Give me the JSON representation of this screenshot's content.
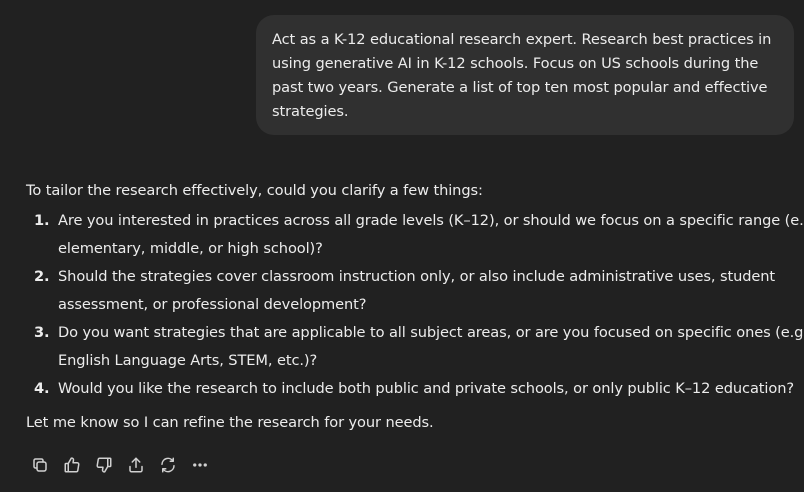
{
  "user_message": {
    "lines": [
      "Act as a K-12 educational research expert. Research best practices in",
      "using generative AI in K-12 schools. Focus on US schools during the",
      "past two years. Generate a list of top ten most popular and effective",
      "strategies."
    ]
  },
  "assistant_message": {
    "intro": "To tailor the research effectively, could you clarify a few things:",
    "questions": [
      {
        "number": "1.",
        "lines": [
          "Are you interested in practices across all grade levels (K–12), or should we focus on a specific range (e.g.,",
          "elementary, middle, or high school)?"
        ]
      },
      {
        "number": "2.",
        "lines": [
          "Should the strategies cover classroom instruction only, or also include administrative uses, student",
          "assessment, or professional development?"
        ]
      },
      {
        "number": "3.",
        "lines": [
          "Do you want strategies that are applicable to all subject areas, or are you focused on specific ones (e.g.,",
          "English Language Arts, STEM, etc.)?"
        ]
      },
      {
        "number": "4.",
        "lines": [
          "Would you like the research to include both public and private schools, or only public K–12 education?"
        ]
      }
    ],
    "outro": "Let me know so I can refine the research for your needs."
  },
  "actions": [
    {
      "name": "copy-button",
      "icon": "copy-icon"
    },
    {
      "name": "thumbs-up-button",
      "icon": "thumbs-up-icon"
    },
    {
      "name": "thumbs-down-button",
      "icon": "thumbs-down-icon"
    },
    {
      "name": "share-button",
      "icon": "share-icon"
    },
    {
      "name": "regenerate-button",
      "icon": "refresh-icon"
    },
    {
      "name": "more-options-button",
      "icon": "more-horizontal-icon"
    }
  ],
  "colors": {
    "background": "#212121",
    "user_bubble": "#303030",
    "text": "#ececec",
    "icon": "#d0d0d0"
  }
}
